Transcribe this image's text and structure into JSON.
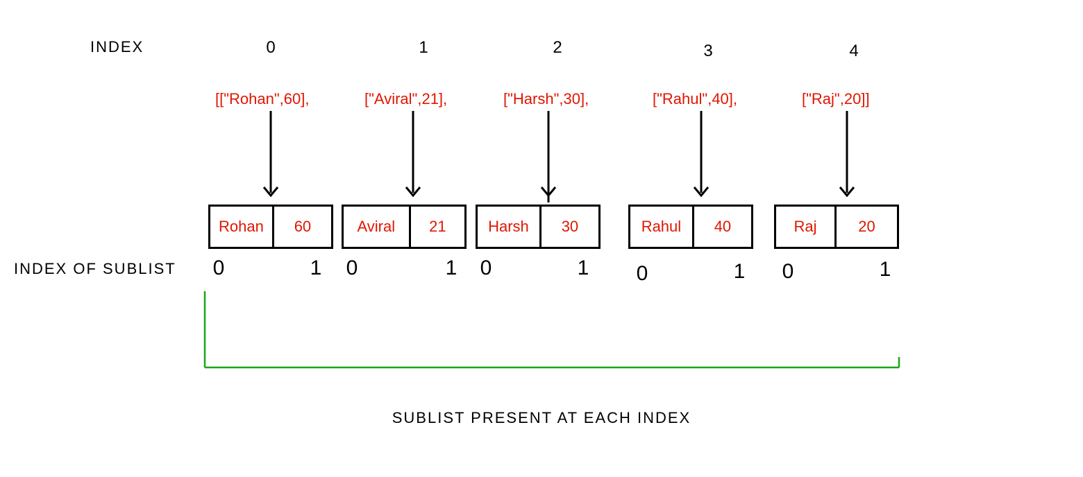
{
  "labels": {
    "index": "INDEX",
    "index_of_sublist": "INDEX OF SUBLIST",
    "caption": "SUBLIST PRESENT AT EACH INDEX"
  },
  "columns": [
    {
      "index": "0",
      "code": "[[\"Rohan\",60],",
      "name": "Rohan",
      "value": "60",
      "sub0": "0",
      "sub1": "1"
    },
    {
      "index": "1",
      "code": "[\"Aviral\",21],",
      "name": "Aviral",
      "value": "21",
      "sub0": "0",
      "sub1": "1"
    },
    {
      "index": "2",
      "code": "[\"Harsh\",30],",
      "name": "Harsh",
      "value": "30",
      "sub0": "0",
      "sub1": "1"
    },
    {
      "index": "3",
      "code": "[\"Rahul\",40],",
      "name": "Rahul",
      "value": "40",
      "sub0": "0",
      "sub1": "1"
    },
    {
      "index": "4",
      "code": "[\"Raj\",20]]",
      "name": "Raj",
      "value": "20",
      "sub0": "0",
      "sub1": "1"
    }
  ],
  "chart_data": {
    "type": "table",
    "description": "Nested list diagram showing outer list indices 0-4 mapping to sublists of [name, number], each sublist having its own indices 0 and 1",
    "outer_list": [
      [
        "Rohan",
        60
      ],
      [
        "Aviral",
        21
      ],
      [
        "Harsh",
        30
      ],
      [
        "Rahul",
        40
      ],
      [
        "Raj",
        20
      ]
    ]
  }
}
